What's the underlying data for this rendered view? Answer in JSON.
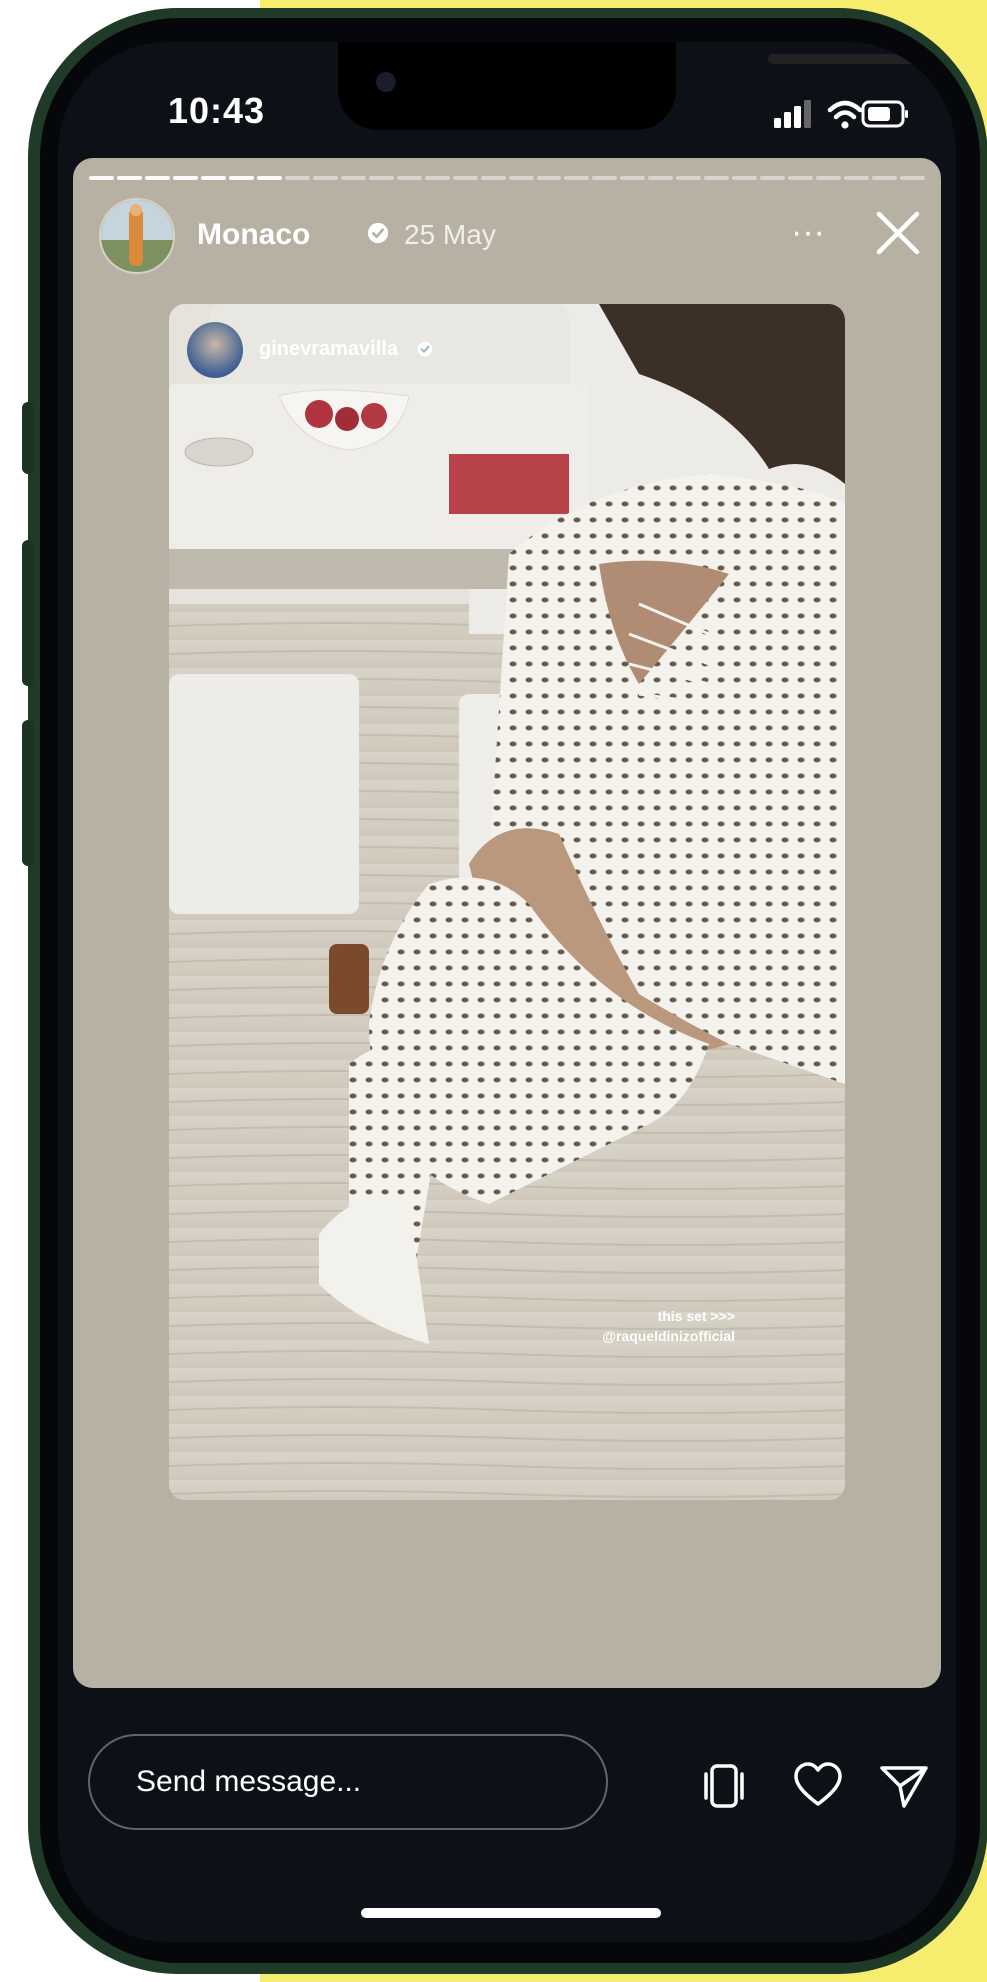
{
  "status_bar": {
    "time": "10:43"
  },
  "story": {
    "progress": {
      "total_segments": 30,
      "completed_segments": 7
    },
    "author": "Monaco",
    "date": "25 May",
    "more_label": "···",
    "photo": {
      "mentioned_user": "ginevramavilla",
      "caption_line1": "this set >>>",
      "caption_line2": "@raqueldinizofficial"
    }
  },
  "composer": {
    "placeholder": "Send message..."
  },
  "colors": {
    "accent_yellow": "#f6ec6e",
    "phone_frame": "#1f3a27",
    "story_background": "#b7b1a4",
    "screen_background": "#0d1117"
  },
  "icons": {
    "signal": "signal-icon",
    "wifi": "wifi-icon",
    "battery": "battery-icon",
    "verified": "verified-icon",
    "close": "close-icon",
    "save": "save-icon",
    "like": "heart-icon",
    "share": "send-icon"
  }
}
